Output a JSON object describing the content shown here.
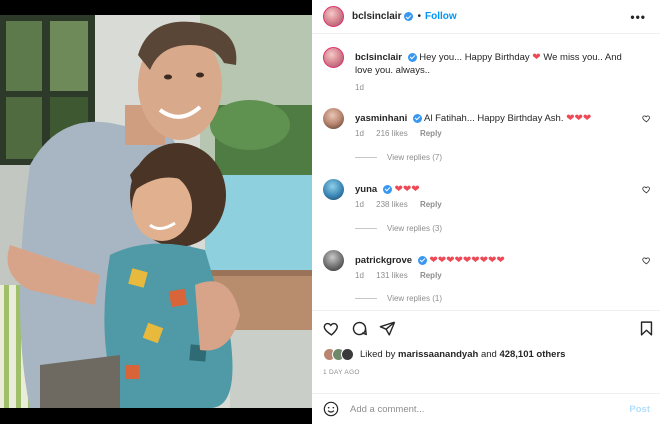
{
  "post": {
    "username": "bclsinclair",
    "separator": "•",
    "follow_label": "Follow",
    "more_label": "•••",
    "caption_user": "bclsinclair",
    "caption_text": "Hey you... Happy Birthday",
    "caption_text_2": "We miss you.. And love you. always..",
    "caption_age": "1d"
  },
  "comments": [
    {
      "user": "yasminhani",
      "text": "Al Fatihah... Happy Birthday Ash.",
      "hearts": "❤❤❤",
      "age": "1d",
      "likes": "216 likes",
      "reply_label": "Reply",
      "view_replies": "View replies (7)"
    },
    {
      "user": "yuna",
      "text": "",
      "hearts": "❤❤❤",
      "age": "1d",
      "likes": "238 likes",
      "reply_label": "Reply",
      "view_replies": "View replies (3)"
    },
    {
      "user": "patrickgrove",
      "text": "",
      "hearts": "❤❤❤❤❤❤❤❤❤",
      "age": "1d",
      "likes": "131 likes",
      "reply_label": "Reply",
      "view_replies": "View replies (1)"
    }
  ],
  "likes": {
    "prefix": "Liked by",
    "user": "marissaanandyah",
    "and": "and",
    "others": "428,101 others"
  },
  "time_ago": "1 DAY AGO",
  "composer": {
    "placeholder": "Add a comment...",
    "post_label": "Post"
  },
  "colors": {
    "accent": "#0095f6",
    "heart": "#ed4956",
    "muted": "#8e8e8e"
  }
}
